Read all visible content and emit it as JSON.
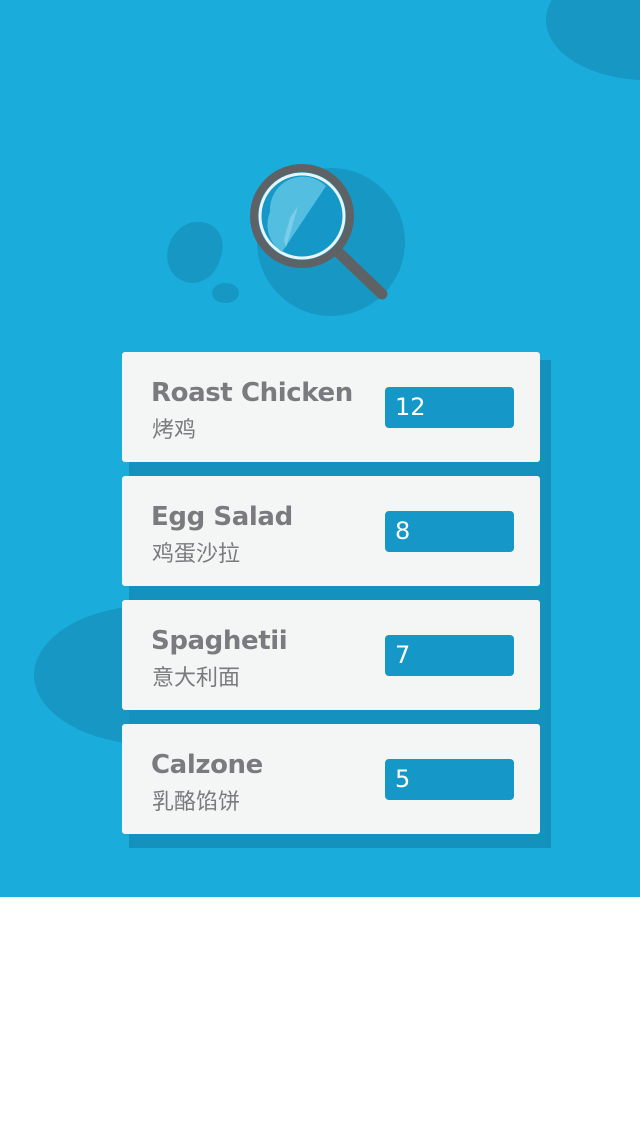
{
  "icons": {
    "search": "magnifier-icon"
  },
  "colors": {
    "background": "#1aaddc",
    "card": "#f4f6f6",
    "input": "#1597c8",
    "text": "#7b7b7f"
  },
  "items": [
    {
      "name": "Roast Chicken",
      "subtitle": "烤鸡",
      "quantity": "12"
    },
    {
      "name": "Egg Salad",
      "subtitle": "鸡蛋沙拉",
      "quantity": "8"
    },
    {
      "name": "Spaghetii",
      "subtitle": "意大利面",
      "quantity": "7"
    },
    {
      "name": "Calzone",
      "subtitle": "乳酪馅饼",
      "quantity": "5"
    }
  ]
}
